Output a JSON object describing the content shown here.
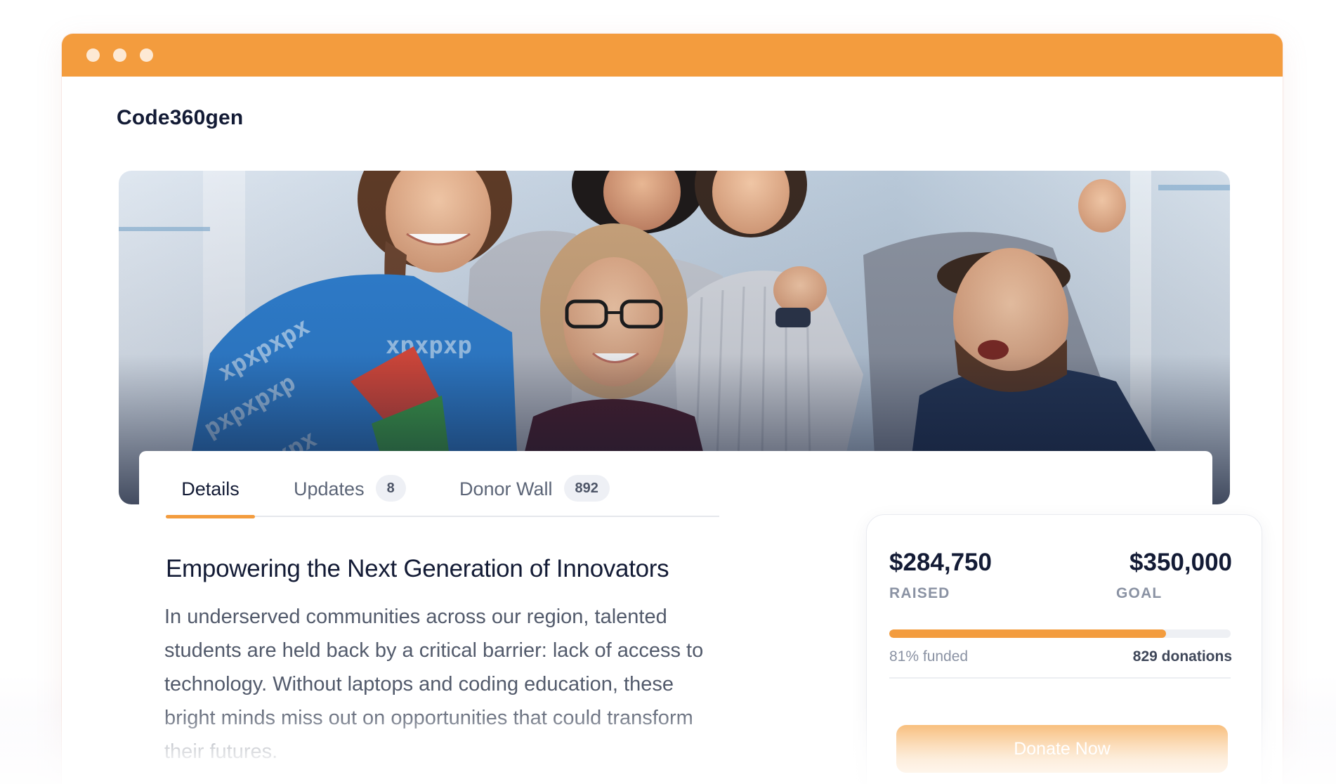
{
  "app": {
    "brand": "Code360gen"
  },
  "hero": {
    "image_name": "team-celebrating-photo"
  },
  "tabs": [
    {
      "label": "Details",
      "active": true
    },
    {
      "label": "Updates",
      "count": "8"
    },
    {
      "label": "Donor Wall",
      "count": "892"
    }
  ],
  "article": {
    "title": "Empowering the Next Generation of Innovators",
    "body": "In underserved communities across our region, talented students are held back by a critical barrier: lack of access to technology. Without laptops and coding education, these bright minds miss out on opportunities that could transform their futures."
  },
  "campaign": {
    "raised": "$284,750",
    "raised_label": "RAISED",
    "goal": "$350,000",
    "goal_label": "GOAL",
    "funded_fraction": 0.81,
    "funded_text": "81% funded",
    "donations_text": "829 donations",
    "donate_label": "Donate Now"
  },
  "colors": {
    "accent": "#f39c3e",
    "ink": "#131b35",
    "muted": "#8a92a3",
    "track": "#eef0f4"
  }
}
